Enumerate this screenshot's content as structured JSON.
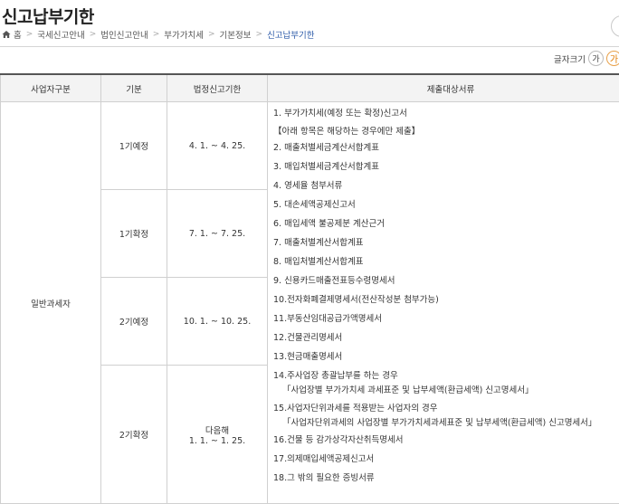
{
  "page": {
    "title": "신고납부기한"
  },
  "breadcrumb": {
    "items": [
      "홈",
      "국세신고안내",
      "법인신고안내",
      "부가가치세",
      "기본정보"
    ],
    "current": "신고납부기한"
  },
  "font_size": {
    "label": "글자크기",
    "small": "가",
    "large": "가"
  },
  "table": {
    "headers": [
      "사업자구분",
      "기분",
      "법정신고기한",
      "제출대상서류"
    ],
    "category": "일반과세자",
    "periods": [
      {
        "name": "1기예정",
        "deadline": "4. 1. ~ 4. 25."
      },
      {
        "name": "1기확정",
        "deadline": "7. 1. ~ 7. 25."
      },
      {
        "name": "2기예정",
        "deadline": "10. 1. ~ 10. 25."
      },
      {
        "name": "2기확정",
        "deadline_line1": "다음해",
        "deadline_line2": "1. 1. ~ 1. 25."
      }
    ],
    "docs": {
      "d1": "1. 부가가치세(예정 또는 확정)신고서",
      "note": "【아래 항목은 해당하는 경우에만 제출】",
      "d2": "2. 매출처별세금계산서합계표",
      "d3": "3. 매입처별세금계산서합계표",
      "d4": "4. 영세율 첨부서류",
      "d5": "5. 대손세액공제신고서",
      "d6": "6. 매입세액 불공제분 계산근거",
      "d7": "7. 매출처별계산서합계표",
      "d8": "8. 매입처별계산서합계표",
      "d9": "9. 신용카드매출전표등수령명세서",
      "d10": "10.전자화폐결제명세서(전산작성분 첨부가능)",
      "d11": "11.부동산임대공급가액명세서",
      "d12": "12.건물관리명세서",
      "d13": "13.현금매출명세서",
      "d14": "14.주사업장 총괄납부를 하는 경우",
      "d14_sub": "「사업장별 부가가치세 과세표준 및 납부세액(환급세액) 신고명세서」",
      "d15": "15.사업자단위과세를 적용받는 사업자의 경우",
      "d15_sub": "「사업자단위과세의 사업장별 부가가치세과세표준 및 납부세액(환급세액) 신고명세서」",
      "d16": "16.건물 등 감가상각자산취득명세서",
      "d17": "17.의제매입세액공제신고서",
      "d18": "18.그 밖의 필요한 증빙서류"
    }
  }
}
